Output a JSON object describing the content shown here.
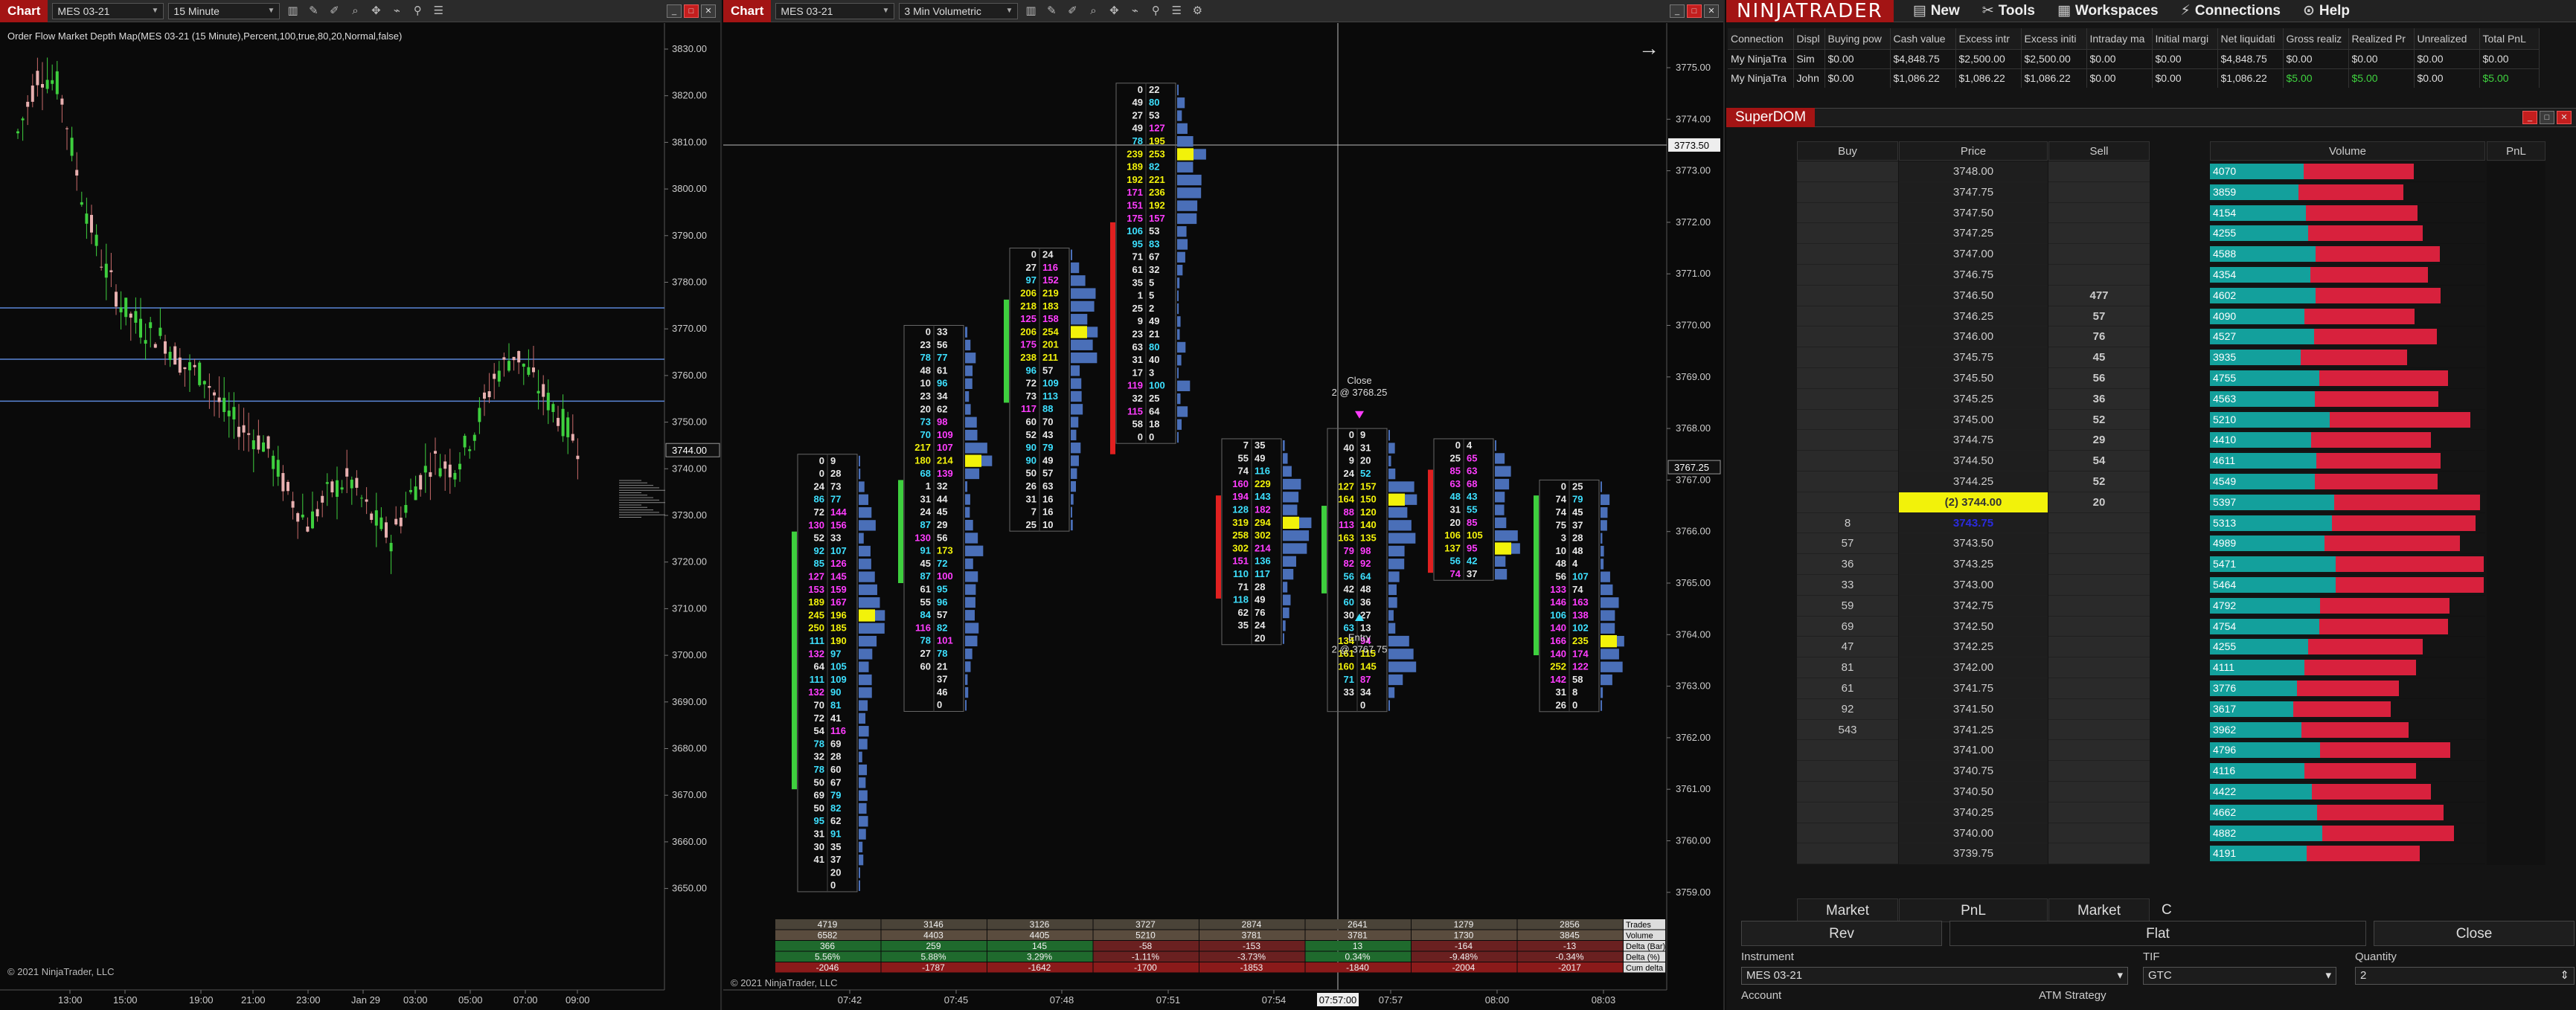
{
  "left_chart": {
    "tab": "Chart",
    "instrument": "MES 03-21",
    "interval": "15 Minute",
    "indicator_label": "Order Flow Market Depth Map(MES 03-21 (15 Minute),Percent,100,true,80,20,Normal,false)",
    "price_axis": [
      "3830.00",
      "3820.00",
      "3810.00",
      "3800.00",
      "3790.00",
      "3780.00",
      "3770.00",
      "3760.00",
      "3750.00",
      "3744.00",
      "3740.00",
      "3730.00",
      "3720.00",
      "3710.00",
      "3700.00",
      "3690.00",
      "3680.00",
      "3670.00",
      "3660.00",
      "3650.00"
    ],
    "current_price": "3744.00",
    "time_axis": [
      "13:00",
      "15:00",
      "19:00",
      "21:00",
      "23:00",
      "Jan 29",
      "03:00",
      "05:00",
      "07:00",
      "09:00"
    ],
    "copyright": "© 2021 NinjaTrader, LLC"
  },
  "mid_chart": {
    "tab": "Chart",
    "instrument": "MES 03-21",
    "interval": "3 Min Volumetric",
    "price_axis": [
      "3775.00",
      "3774.00",
      "3773.50",
      "3773.00",
      "3772.00",
      "3771.00",
      "3770.00",
      "3769.00",
      "3768.00",
      "3767.25",
      "3767.00",
      "3766.00",
      "3765.00",
      "3764.00",
      "3763.00",
      "3762.00",
      "3761.00",
      "3760.00",
      "3759.00"
    ],
    "crosshair_price": "3773.50",
    "current_price": "3767.25",
    "time_axis": [
      "07:42",
      "07:45",
      "07:48",
      "07:51",
      "07:54",
      "07:57:00",
      "07:57",
      "08:00",
      "08:03"
    ],
    "close_label": "Close",
    "close_detail": "2 @ 3768.25",
    "entry_label": "Entry",
    "entry_detail": "2 @ 3767.75",
    "copyright": "© 2021 NinjaTrader, LLC",
    "footer_labels": [
      "Trades",
      "Volume",
      "Delta (Bar)",
      "Delta (%)",
      "Cum delta"
    ],
    "footer_rows": [
      [
        "4719",
        "3146",
        "3126",
        "3727",
        "2874",
        "2641",
        "1279",
        "2856"
      ],
      [
        "6582",
        "4403",
        "4405",
        "5210",
        "3781",
        "3781",
        "1730",
        "3845"
      ],
      [
        "366",
        "259",
        "145",
        "-58",
        "-153",
        "13",
        "-164",
        "-13"
      ],
      [
        "5.56%",
        "5.88%",
        "3.29%",
        "-1.11%",
        "-3.73%",
        "0.34%",
        "-9.48%",
        "-0.34%"
      ],
      [
        "-2046",
        "-1787",
        "-1642",
        "-1700",
        "-1853",
        "-1840",
        "-2004",
        "-2017"
      ]
    ]
  },
  "footprints": [
    {
      "bid": [
        "0",
        "0",
        "24",
        "86",
        "72",
        "130",
        "52",
        "92",
        "85",
        "127",
        "153",
        "189",
        "245",
        "250",
        "111",
        "132",
        "64",
        "111",
        "132",
        "70",
        "72",
        "54",
        "78",
        "32",
        "78",
        "50",
        "69",
        "50",
        "95",
        "31",
        "30",
        "41"
      ],
      "ask": [
        "9",
        "28",
        "73",
        "77",
        "144",
        "156",
        "33",
        "107",
        "126",
        "145",
        "159",
        "167",
        "196",
        "185",
        "190",
        "97",
        "105",
        "109",
        "90",
        "81",
        "41",
        "116",
        "69",
        "28",
        "60",
        "67",
        "79",
        "82",
        "62",
        "91",
        "35",
        "37",
        "20",
        "0"
      ]
    },
    {
      "bid": [
        "0",
        "23",
        "78",
        "48",
        "10",
        "23",
        "20",
        "73",
        "70",
        "217",
        "180",
        "68",
        "1",
        "31",
        "24",
        "87",
        "130",
        "91",
        "45",
        "87",
        "61",
        "55",
        "84",
        "116",
        "78",
        "27",
        "60"
      ],
      "ask": [
        "33",
        "56",
        "77",
        "61",
        "96",
        "34",
        "62",
        "98",
        "109",
        "107",
        "214",
        "139",
        "32",
        "44",
        "45",
        "29",
        "56",
        "173",
        "72",
        "100",
        "95",
        "96",
        "57",
        "82",
        "101",
        "78",
        "21",
        "37",
        "46",
        "0"
      ]
    },
    {
      "bid": [
        "0",
        "27",
        "97",
        "206",
        "218",
        "125",
        "206",
        "175",
        "238",
        "96",
        "72",
        "73",
        "117",
        "60",
        "52",
        "90",
        "90",
        "50",
        "26",
        "31",
        "7",
        "25"
      ],
      "ask": [
        "24",
        "116",
        "152",
        "219",
        "183",
        "158",
        "254",
        "201",
        "211",
        "57",
        "109",
        "113",
        "88",
        "70",
        "43",
        "79",
        "49",
        "57",
        "63",
        "16",
        "16",
        "10"
      ]
    },
    {
      "bid": [
        "0",
        "49",
        "27",
        "49",
        "78",
        "239",
        "189",
        "192",
        "171",
        "151",
        "175",
        "106",
        "95",
        "71",
        "61",
        "35",
        "1",
        "25",
        "9",
        "23",
        "63",
        "31",
        "17",
        "119",
        "32",
        "115",
        "58",
        "0"
      ],
      "ask": [
        "22",
        "80",
        "53",
        "127",
        "195",
        "253",
        "82",
        "221",
        "236",
        "192",
        "157",
        "53",
        "83",
        "67",
        "32",
        "5",
        "5",
        "2",
        "49",
        "21",
        "80",
        "40",
        "3",
        "100",
        "25",
        "64",
        "18",
        "0"
      ]
    },
    {
      "bid": [
        "7",
        "55",
        "74",
        "160",
        "194",
        "128",
        "319",
        "258",
        "302",
        "151",
        "110",
        "71",
        "118",
        "62",
        "35"
      ],
      "ask": [
        "35",
        "49",
        "116",
        "229",
        "143",
        "182",
        "294",
        "302",
        "214",
        "136",
        "117",
        "28",
        "49",
        "76",
        "24",
        "20"
      ]
    },
    {
      "bid": [
        "0",
        "40",
        "9",
        "24",
        "127",
        "164",
        "88",
        "113",
        "163",
        "79",
        "82",
        "56",
        "42",
        "60",
        "30",
        "63",
        "134",
        "161",
        "160",
        "71",
        "33"
      ],
      "ask": [
        "9",
        "31",
        "20",
        "52",
        "157",
        "150",
        "120",
        "140",
        "135",
        "98",
        "92",
        "64",
        "48",
        "36",
        "27",
        "13",
        "94",
        "115",
        "145",
        "87",
        "34",
        "0"
      ]
    },
    {
      "bid": [
        "0",
        "25",
        "85",
        "63",
        "48",
        "31",
        "20",
        "106",
        "137",
        "56",
        "74"
      ],
      "ask": [
        "4",
        "65",
        "63",
        "68",
        "43",
        "55",
        "85",
        "105",
        "95",
        "42",
        "37"
      ]
    },
    {
      "bid": [
        "0",
        "74",
        "74",
        "75",
        "3",
        "10",
        "48",
        "56",
        "133",
        "146",
        "106",
        "140",
        "166",
        "140",
        "252",
        "142",
        "31",
        "26"
      ],
      "ask": [
        "25",
        "79",
        "45",
        "37",
        "28",
        "48",
        "4",
        "107",
        "74",
        "163",
        "138",
        "102",
        "235",
        "174",
        "122",
        "58",
        "8",
        "0"
      ]
    }
  ],
  "ninjatrader": {
    "logo": "NINJATRADER",
    "menu": [
      {
        "icon": "new-icon",
        "label": "New"
      },
      {
        "icon": "tools-icon",
        "label": "Tools"
      },
      {
        "icon": "workspaces-icon",
        "label": "Workspaces"
      },
      {
        "icon": "connections-icon",
        "label": "Connections"
      },
      {
        "icon": "help-icon",
        "label": "Help"
      }
    ]
  },
  "accounts": {
    "headers": [
      "Connection",
      "Displ",
      "Buying pow",
      "Cash value",
      "Excess intr",
      "Excess initi",
      "Intraday ma",
      "Initial margi",
      "Net liquidati",
      "Gross realiz",
      "Realized Pr",
      "Unrealized",
      "Total PnL"
    ],
    "rows": [
      [
        "My NinjaTra",
        "Sim",
        "$0.00",
        "$4,848.75",
        "$2,500.00",
        "$2,500.00",
        "$0.00",
        "$0.00",
        "$4,848.75",
        "$0.00",
        "$0.00",
        "$0.00",
        "$0.00"
      ],
      [
        "My NinjaTra",
        "John",
        "$0.00",
        "$1,086.22",
        "$1,086.22",
        "$1,086.22",
        "$0.00",
        "$0.00",
        "$1,086.22",
        "$5.00",
        "$5.00",
        "$0.00",
        "$5.00"
      ]
    ]
  },
  "superdom": {
    "title": "SuperDOM",
    "headers": {
      "buy": "Buy",
      "price": "Price",
      "sell": "Sell",
      "volume": "Volume",
      "pnl": "PnL"
    },
    "rows": [
      {
        "price": "3748.00",
        "buy": "",
        "sell": "",
        "vol": "4070"
      },
      {
        "price": "3747.75",
        "buy": "",
        "sell": "",
        "vol": "3859"
      },
      {
        "price": "3747.50",
        "buy": "",
        "sell": "",
        "vol": "4154"
      },
      {
        "price": "3747.25",
        "buy": "",
        "sell": "",
        "vol": "4255"
      },
      {
        "price": "3747.00",
        "buy": "",
        "sell": "",
        "vol": "4588"
      },
      {
        "price": "3746.75",
        "buy": "",
        "sell": "",
        "vol": "4354"
      },
      {
        "price": "3746.50",
        "buy": "",
        "sell": "477",
        "vol": "4602"
      },
      {
        "price": "3746.25",
        "buy": "",
        "sell": "57",
        "vol": "4090"
      },
      {
        "price": "3746.00",
        "buy": "",
        "sell": "76",
        "vol": "4527"
      },
      {
        "price": "3745.75",
        "buy": "",
        "sell": "45",
        "vol": "3935"
      },
      {
        "price": "3745.50",
        "buy": "",
        "sell": "56",
        "vol": "4755"
      },
      {
        "price": "3745.25",
        "buy": "",
        "sell": "36",
        "vol": "4563"
      },
      {
        "price": "3745.00",
        "buy": "",
        "sell": "52",
        "vol": "5210"
      },
      {
        "price": "3744.75",
        "buy": "",
        "sell": "29",
        "vol": "4410"
      },
      {
        "price": "3744.50",
        "buy": "",
        "sell": "54",
        "vol": "4611"
      },
      {
        "price": "3744.25",
        "buy": "",
        "sell": "52",
        "vol": "4549"
      },
      {
        "price": "(2) 3744.00",
        "buy": "",
        "sell": "20",
        "vol": "5397",
        "state": "cur"
      },
      {
        "price": "3743.75",
        "buy": "8",
        "sell": "",
        "vol": "5313",
        "state": "bidp"
      },
      {
        "price": "3743.50",
        "buy": "57",
        "sell": "",
        "vol": "4989"
      },
      {
        "price": "3743.25",
        "buy": "36",
        "sell": "",
        "vol": "5471"
      },
      {
        "price": "3743.00",
        "buy": "33",
        "sell": "",
        "vol": "5464"
      },
      {
        "price": "3742.75",
        "buy": "59",
        "sell": "",
        "vol": "4792"
      },
      {
        "price": "3742.50",
        "buy": "69",
        "sell": "",
        "vol": "4754"
      },
      {
        "price": "3742.25",
        "buy": "47",
        "sell": "",
        "vol": "4255"
      },
      {
        "price": "3742.00",
        "buy": "81",
        "sell": "",
        "vol": "4111"
      },
      {
        "price": "3741.75",
        "buy": "61",
        "sell": "",
        "vol": "3776"
      },
      {
        "price": "3741.50",
        "buy": "92",
        "sell": "",
        "vol": "3617"
      },
      {
        "price": "3741.25",
        "buy": "543",
        "sell": "",
        "vol": "3962"
      },
      {
        "price": "3741.00",
        "buy": "",
        "sell": "",
        "vol": "4796"
      },
      {
        "price": "3740.75",
        "buy": "",
        "sell": "",
        "vol": "4116"
      },
      {
        "price": "3740.50",
        "buy": "",
        "sell": "",
        "vol": "4422"
      },
      {
        "price": "3740.25",
        "buy": "",
        "sell": "",
        "vol": "4662"
      },
      {
        "price": "3740.00",
        "buy": "",
        "sell": "",
        "vol": "4882"
      },
      {
        "price": "3739.75",
        "buy": "",
        "sell": "",
        "vol": "4191"
      }
    ],
    "vol_max": 5500,
    "footer": {
      "market_buy": "Market",
      "pnl": "PnL",
      "market_sell": "Market",
      "c": "C"
    },
    "buttons": {
      "rev": "Rev",
      "flat": "Flat",
      "close": "Close"
    },
    "instrument_label": "Instrument",
    "instrument_value": "MES 03-21",
    "tif_label": "TIF",
    "tif_value": "GTC",
    "quantity_label": "Quantity",
    "quantity_value": "2",
    "account_label": "Account",
    "atm_label": "ATM Strategy"
  },
  "colors": {
    "tab_red": "#a31414",
    "bull": "#3ecf3e",
    "bear": "#e02020",
    "profile": "#4a6fb8",
    "highlight": "#f2f20a",
    "teal": "#13a09c",
    "crimson": "#d8213d"
  }
}
